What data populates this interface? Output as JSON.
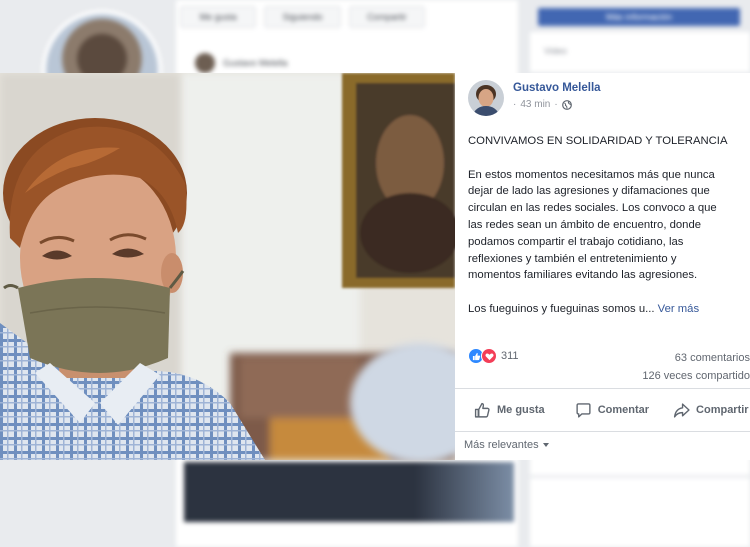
{
  "background": {
    "tabs": [
      "Me gusta",
      "Siguiendo",
      "Compartir"
    ],
    "post_author": "Gustavo Melella",
    "right_button": "Más información",
    "right_text": "Video"
  },
  "post": {
    "author": "Gustavo Melella",
    "time": "43 min",
    "paragraphs": [
      "CONVIVAMOS EN SOLIDARIDAD Y TOLERANCIA",
      [
        "En estos momentos necesitamos más que nunca",
        "dejar de lado las agresiones y difamaciones que",
        "circulan en las redes sociales. Los convoco a que",
        "las redes sean un ámbito de encuentro, donde",
        "podamos compartir el trabajo cotidiano, las",
        "reflexiones y también el entretenimiento y",
        "momentos familiares evitando las agresiones."
      ]
    ],
    "truncated_line": "Los fueguinos y fueguinas somos u...",
    "see_more": "Ver más",
    "reaction_count": "311",
    "comments": "63 comentarios",
    "shares": "126 veces compartido"
  },
  "actions": {
    "like": "Me gusta",
    "comment": "Comentar",
    "share": "Compartir"
  },
  "sort_label": "Más relevantes",
  "colors": {
    "link": "#365899",
    "like_blue": "#2d88ff",
    "love_red": "#f33e58",
    "muted": "#90949c"
  }
}
